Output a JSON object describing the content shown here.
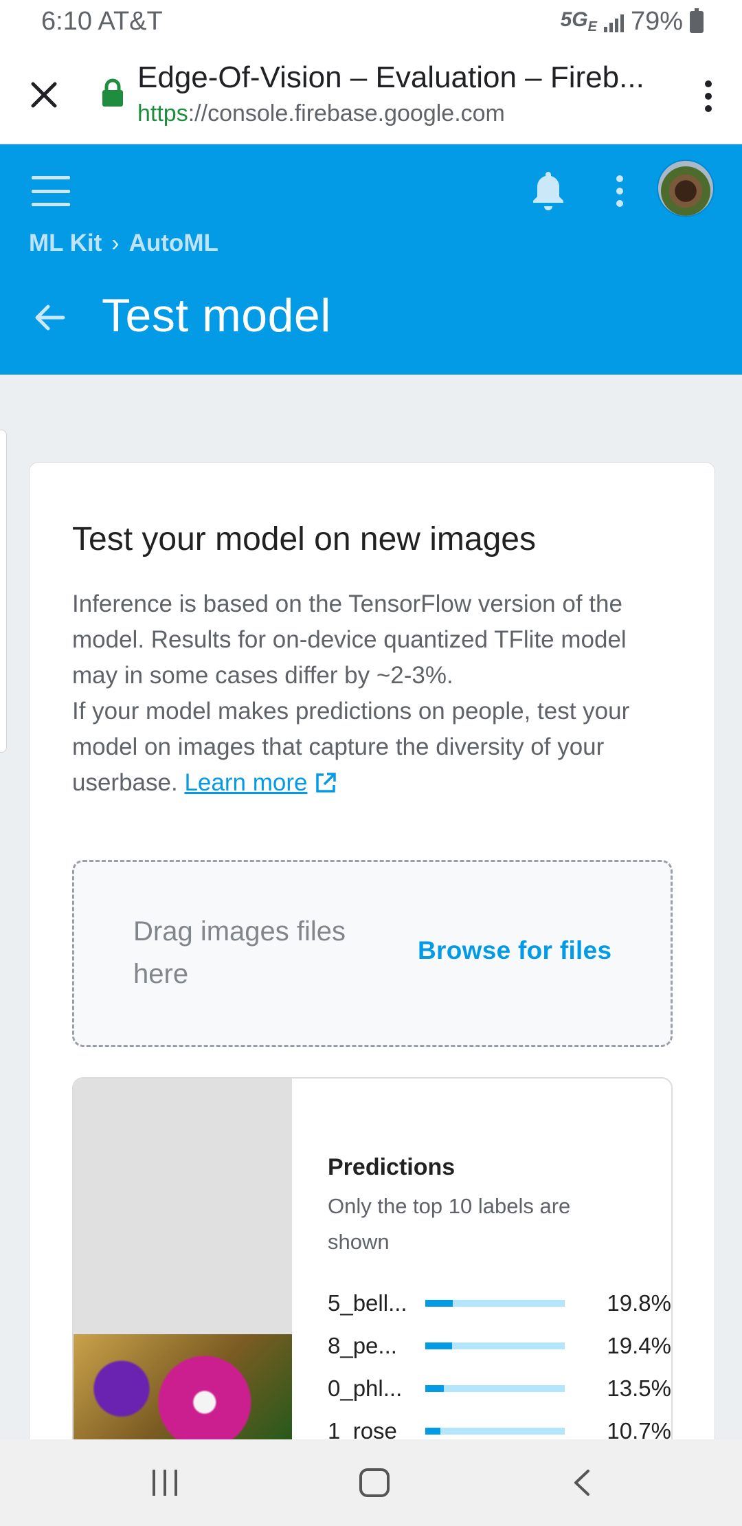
{
  "status_bar": {
    "time": "6:10",
    "carrier": "AT&T",
    "network": "5G",
    "network_sub": "E",
    "battery": "79%"
  },
  "browser": {
    "title": "Edge-Of-Vision – Evaluation – Fireb...",
    "url_scheme": "https",
    "url_sep": "://",
    "url_host": "console.firebase.google.com"
  },
  "header": {
    "breadcrumb": [
      "ML Kit",
      "AutoML"
    ],
    "title": "Test model"
  },
  "card": {
    "title": "Test your model on new images",
    "desc_line1": "Inference is based on the TensorFlow version of the model. Results for on-device quantized TFlite model may in some cases differ by ~2-3%.",
    "desc_line2": "If your model makes predictions on people, test your model on images that capture the diversity of your userbase.",
    "learn_more": "Learn more"
  },
  "dropzone": {
    "text": "Drag images files here",
    "browse": "Browse for files"
  },
  "predictions": {
    "title": "Predictions",
    "subtitle": "Only the top 10 labels are shown",
    "items": [
      {
        "label": "5_bell...",
        "value": "19.8%",
        "fraction": 0.198
      },
      {
        "label": "8_pe...",
        "value": "19.4%",
        "fraction": 0.194
      },
      {
        "label": "0_phl...",
        "value": "13.5%",
        "fraction": 0.135
      },
      {
        "label": "1_rose",
        "value": "10.7%",
        "fraction": 0.107
      }
    ]
  },
  "colors": {
    "firebase_blue": "#039be5",
    "bar_track": "#b3e5fc",
    "secure_green": "#1e8e3e"
  },
  "icons": [
    "close-icon",
    "lock-icon",
    "more-vert-icon",
    "menu-icon",
    "bell-icon",
    "back-arrow-icon",
    "external-link-icon"
  ]
}
